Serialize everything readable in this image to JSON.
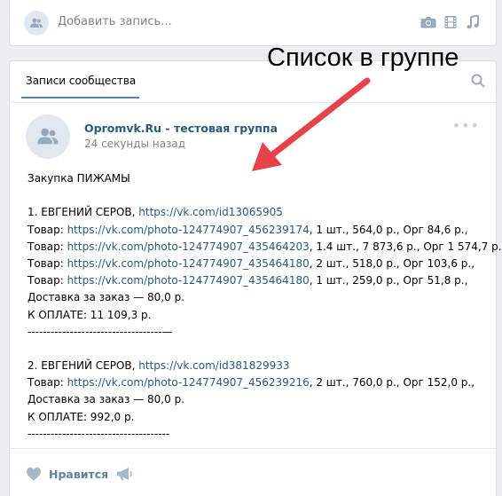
{
  "compose": {
    "placeholder": "Добавить запись..."
  },
  "wall": {
    "tab_label": "Записи сообщества"
  },
  "annotation": {
    "text": "Список в группе"
  },
  "post": {
    "author": "Opromvk.Ru - тестовая группа",
    "time": "24 секунды назад",
    "lines": [
      {
        "parts": [
          {
            "t": "Закупка ПИЖАМЫ"
          }
        ]
      },
      {
        "parts": [
          {
            "t": ""
          }
        ]
      },
      {
        "parts": [
          {
            "t": "1. ЕВГЕНИЙ СЕРОВ, "
          },
          {
            "t": "https://vk.com/id13065905",
            "link": true
          }
        ]
      },
      {
        "parts": [
          {
            "t": "Товар: "
          },
          {
            "t": "https://vk.com/photo-124774907_456239174",
            "link": true
          },
          {
            "t": ", 1 шт., 564,0 р., Орг 84,6 р.,"
          }
        ]
      },
      {
        "parts": [
          {
            "t": "Товар: "
          },
          {
            "t": "https://vk.com/photo-124774907_435464203",
            "link": true
          },
          {
            "t": ", 1.4 шт., 7 873,6 р., Орг 1 574,7 р.,"
          }
        ]
      },
      {
        "parts": [
          {
            "t": "Товар: "
          },
          {
            "t": "https://vk.com/photo-124774907_435464180",
            "link": true
          },
          {
            "t": ", 2 шт., 518,0 р., Орг 103,6 р.,"
          }
        ]
      },
      {
        "parts": [
          {
            "t": "Товар: "
          },
          {
            "t": "https://vk.com/photo-124774907_435464180",
            "link": true
          },
          {
            "t": ", 1 шт., 259,0 р., Орг 51,8 р.,"
          }
        ]
      },
      {
        "parts": [
          {
            "t": "Доставка за заказ — 80,0 р."
          }
        ]
      },
      {
        "parts": [
          {
            "t": "К ОПЛАТЕ: 11 109,3 р."
          }
        ]
      },
      {
        "parts": [
          {
            "t": "-----------------------------------—"
          }
        ]
      },
      {
        "parts": [
          {
            "t": ""
          }
        ]
      },
      {
        "parts": [
          {
            "t": "2. ЕВГЕНИЙ СЕРОВ, "
          },
          {
            "t": "https://vk.com/id381829933",
            "link": true
          }
        ]
      },
      {
        "parts": [
          {
            "t": "Товар: "
          },
          {
            "t": "https://vk.com/photo-124774907_456239216",
            "link": true
          },
          {
            "t": ", 2 шт., 760,0 р., Орг 152,0 р.,"
          }
        ]
      },
      {
        "parts": [
          {
            "t": "Доставка за заказ — 80,0 р."
          }
        ]
      },
      {
        "parts": [
          {
            "t": "К ОПЛАТЕ: 992,0 р."
          }
        ]
      },
      {
        "parts": [
          {
            "t": "-------------------------------------"
          }
        ]
      }
    ],
    "like_label": "Нравится"
  },
  "colors": {
    "background": "#edeef0",
    "link": "#2a5885",
    "accent": "#5181b8",
    "arrow": "#e8414a"
  },
  "icons": [
    "community-icon",
    "camera-icon",
    "video-icon",
    "music-icon",
    "search-icon",
    "more-icon",
    "heart-icon",
    "megaphone-icon"
  ]
}
